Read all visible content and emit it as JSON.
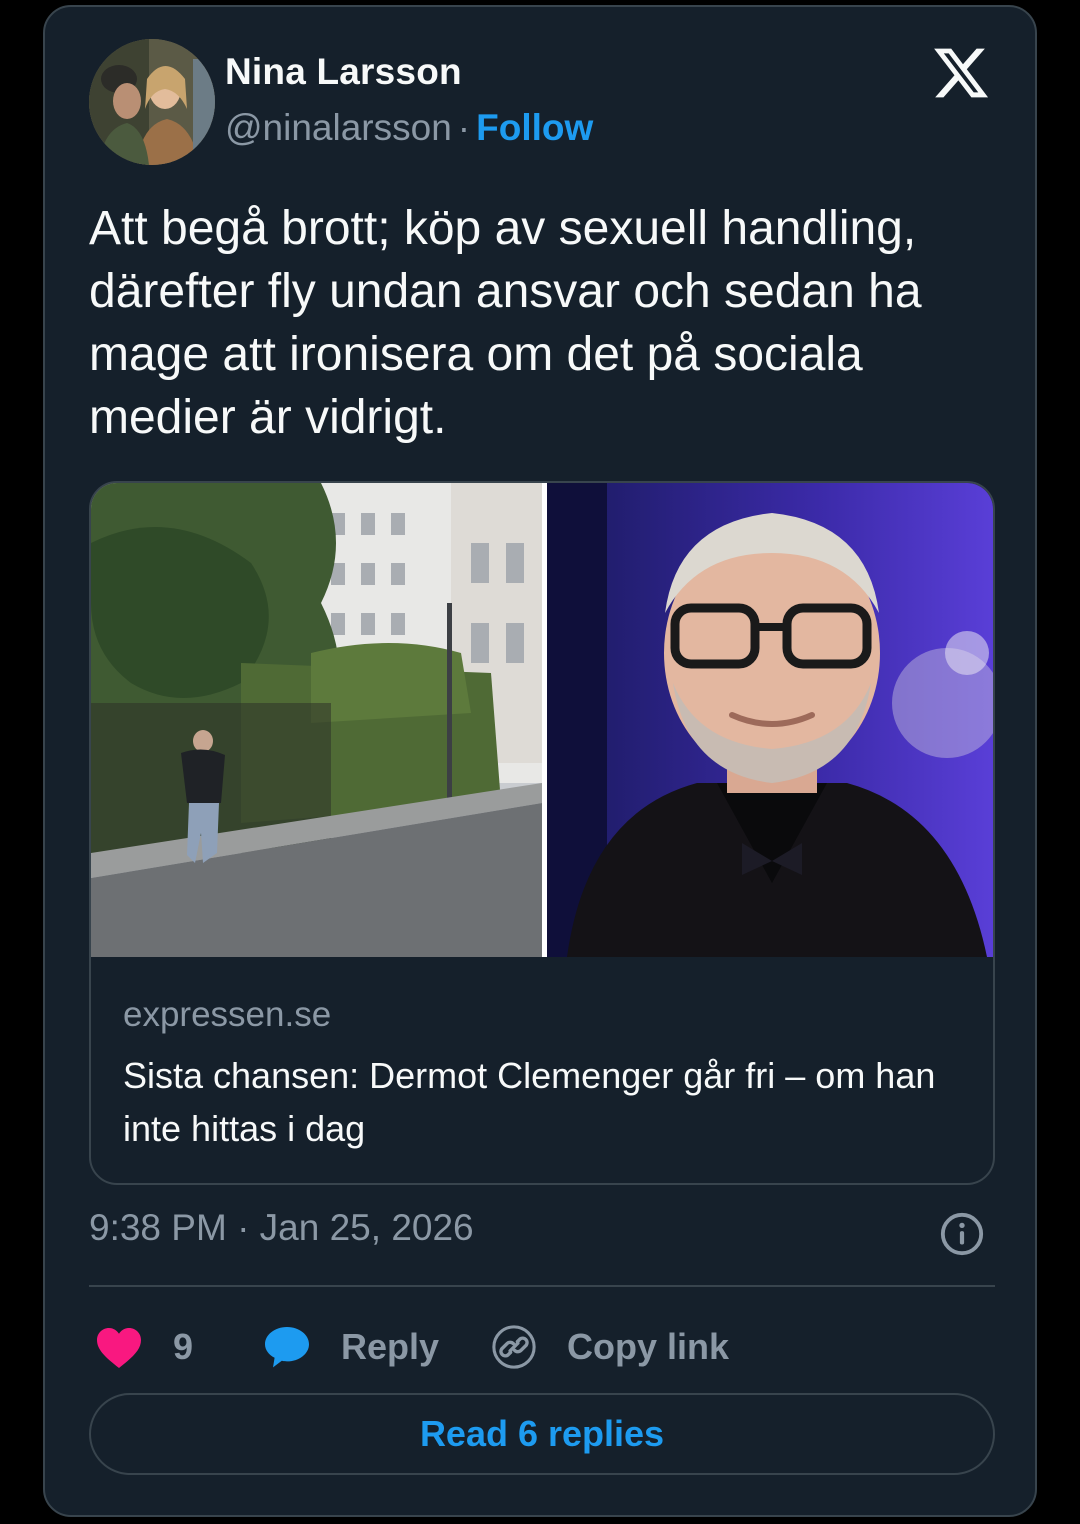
{
  "author": {
    "name": "Nina Larsson",
    "handle": "@ninalarsson",
    "separator": "·",
    "follow_label": "Follow"
  },
  "tweet": {
    "text": "Att begå brott; köp av sexuell handling, därefter fly undan ansvar och sedan ha mage att ironisera om det på sociala medier är vidrigt."
  },
  "link_card": {
    "domain": "expressen.se",
    "headline": "Sista chansen: Dermot Clemenger går fri – om han inte hittas i dag"
  },
  "meta": {
    "timestamp": "9:38 PM · Jan 25, 2026"
  },
  "actions": {
    "like_count": "9",
    "reply_label": "Reply",
    "copy_link_label": "Copy link"
  },
  "footer": {
    "read_replies_label": "Read 6 replies"
  },
  "icons": {
    "logo": "x-logo-icon",
    "info": "info-icon",
    "like": "heart-icon",
    "reply": "speech-bubble-icon",
    "copy": "link-icon"
  },
  "colors": {
    "background": "#15202b",
    "accent": "#1d9bf0",
    "heart": "#f91880",
    "text": "#f7f9f9",
    "muted": "#8b98a5",
    "border": "#38444d"
  }
}
